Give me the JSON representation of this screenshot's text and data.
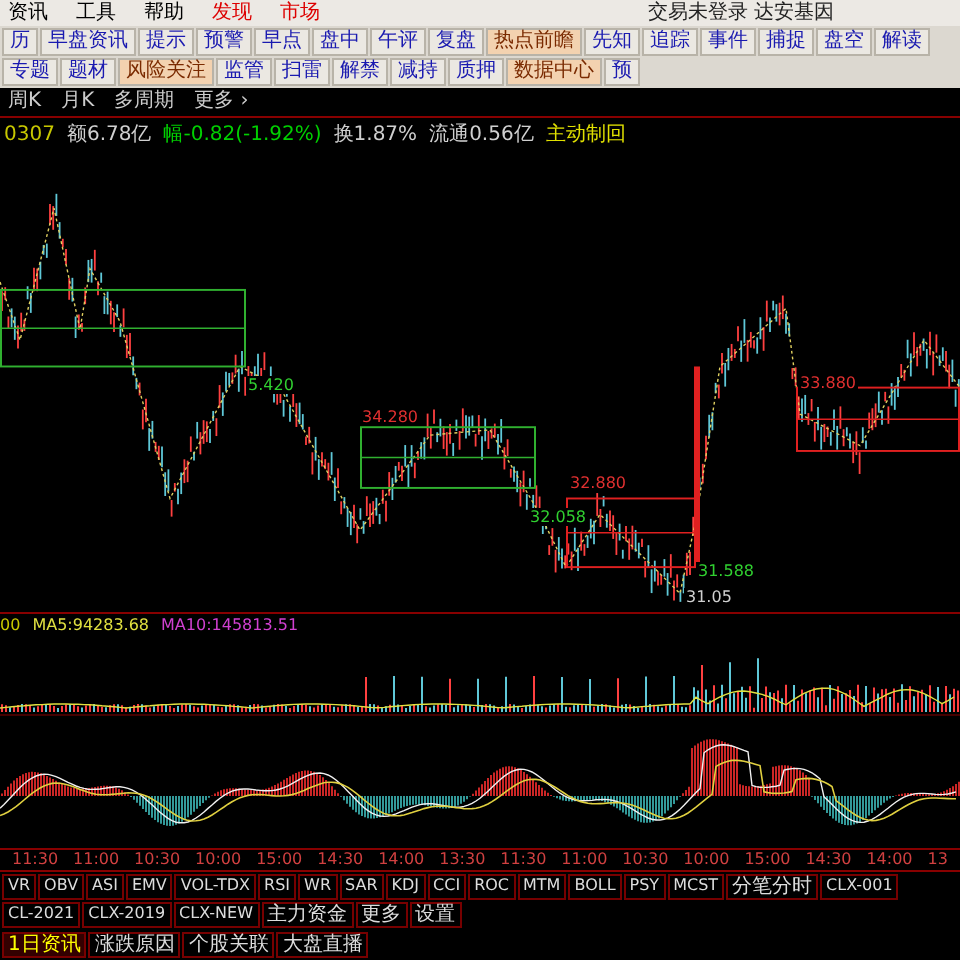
{
  "menu": {
    "items": [
      {
        "label": "资讯",
        "kind": "normal"
      },
      {
        "label": "工具",
        "kind": "normal"
      },
      {
        "label": "帮助",
        "kind": "normal"
      },
      {
        "label": "发现",
        "kind": "alert"
      },
      {
        "label": "市场",
        "kind": "alert"
      }
    ],
    "title": "交易未登录 达安基因"
  },
  "toolbar": [
    {
      "label": "历",
      "highlighted": false
    },
    {
      "label": "早盘资讯",
      "highlighted": false
    },
    {
      "label": "提示",
      "highlighted": false
    },
    {
      "label": "预警",
      "highlighted": false
    },
    {
      "label": "早点",
      "highlighted": false
    },
    {
      "label": "盘中",
      "highlighted": false
    },
    {
      "label": "午评",
      "highlighted": false
    },
    {
      "label": "复盘",
      "highlighted": false
    },
    {
      "label": "热点前瞻",
      "highlighted": true
    },
    {
      "label": "先知",
      "highlighted": false
    },
    {
      "label": "追踪",
      "highlighted": false
    },
    {
      "label": "事件",
      "highlighted": false
    },
    {
      "label": "捕捉",
      "highlighted": false
    },
    {
      "label": "盘空",
      "highlighted": false
    },
    {
      "label": "解读",
      "highlighted": false
    },
    {
      "label": "专题",
      "highlighted": false
    },
    {
      "label": "题材",
      "highlighted": false
    },
    {
      "label": "风险关注",
      "highlighted": true
    },
    {
      "label": "监管",
      "highlighted": false
    },
    {
      "label": "扫雷",
      "highlighted": false
    },
    {
      "label": "解禁",
      "highlighted": false
    },
    {
      "label": "减持",
      "highlighted": false
    },
    {
      "label": "质押",
      "highlighted": false
    },
    {
      "label": "数据中心",
      "highlighted": true
    },
    {
      "label": "预",
      "highlighted": false
    }
  ],
  "periods": [
    "周K",
    "月K",
    "多周期",
    "更多 ›"
  ],
  "quote": [
    {
      "text": "0307",
      "kind": "code"
    },
    {
      "text": "额6.78亿",
      "kind": "plain"
    },
    {
      "text": "幅-0.82(-1.92%)",
      "kind": "down"
    },
    {
      "text": "换1.87%",
      "kind": "plain"
    },
    {
      "text": "流通0.56亿",
      "kind": "plain"
    },
    {
      "text": "主动制回",
      "kind": "info"
    }
  ],
  "price_chart": {
    "labels": [
      {
        "text": "5.420",
        "kind": "support"
      },
      {
        "text": "34.280",
        "kind": "resistance"
      },
      {
        "text": "32.058",
        "kind": "support"
      },
      {
        "text": "32.880",
        "kind": "resistance"
      },
      {
        "text": "31.588",
        "kind": "support"
      },
      {
        "text": "31.05",
        "kind": "low"
      },
      {
        "text": "33.880",
        "kind": "resistance"
      }
    ]
  },
  "volume": {
    "legend": [
      {
        "text": "00",
        "kind": "vol"
      },
      {
        "text": "MA5:94283.68",
        "kind": "ma5"
      },
      {
        "text": "MA10:145813.51",
        "kind": "ma10"
      }
    ]
  },
  "time_axis": [
    "11:30",
    "11:00",
    "10:30",
    "10:00",
    "15:00",
    "14:30",
    "14:00",
    "13:30",
    "11:30",
    "11:00",
    "10:30",
    "10:00",
    "15:00",
    "14:30",
    "14:00",
    "13"
  ],
  "indicator_tabs": [
    "VR",
    "OBV",
    "ASI",
    "EMV",
    "VOL-TDX",
    "RSI",
    "WR",
    "SAR",
    "KDJ",
    "CCI",
    "ROC",
    "MTM",
    "BOLL",
    "PSY",
    "MCST",
    "分笔分时",
    "CLX-001",
    "CL-2021",
    "CLX-2019",
    "CLX-NEW",
    "主力资金",
    "更多",
    "设置"
  ],
  "news_tabs": [
    {
      "label": "1日资讯",
      "selected": true
    },
    {
      "label": "涨跌原因",
      "selected": false
    },
    {
      "label": "个股关联",
      "selected": false
    },
    {
      "label": "大盘直播",
      "selected": false
    }
  ]
}
